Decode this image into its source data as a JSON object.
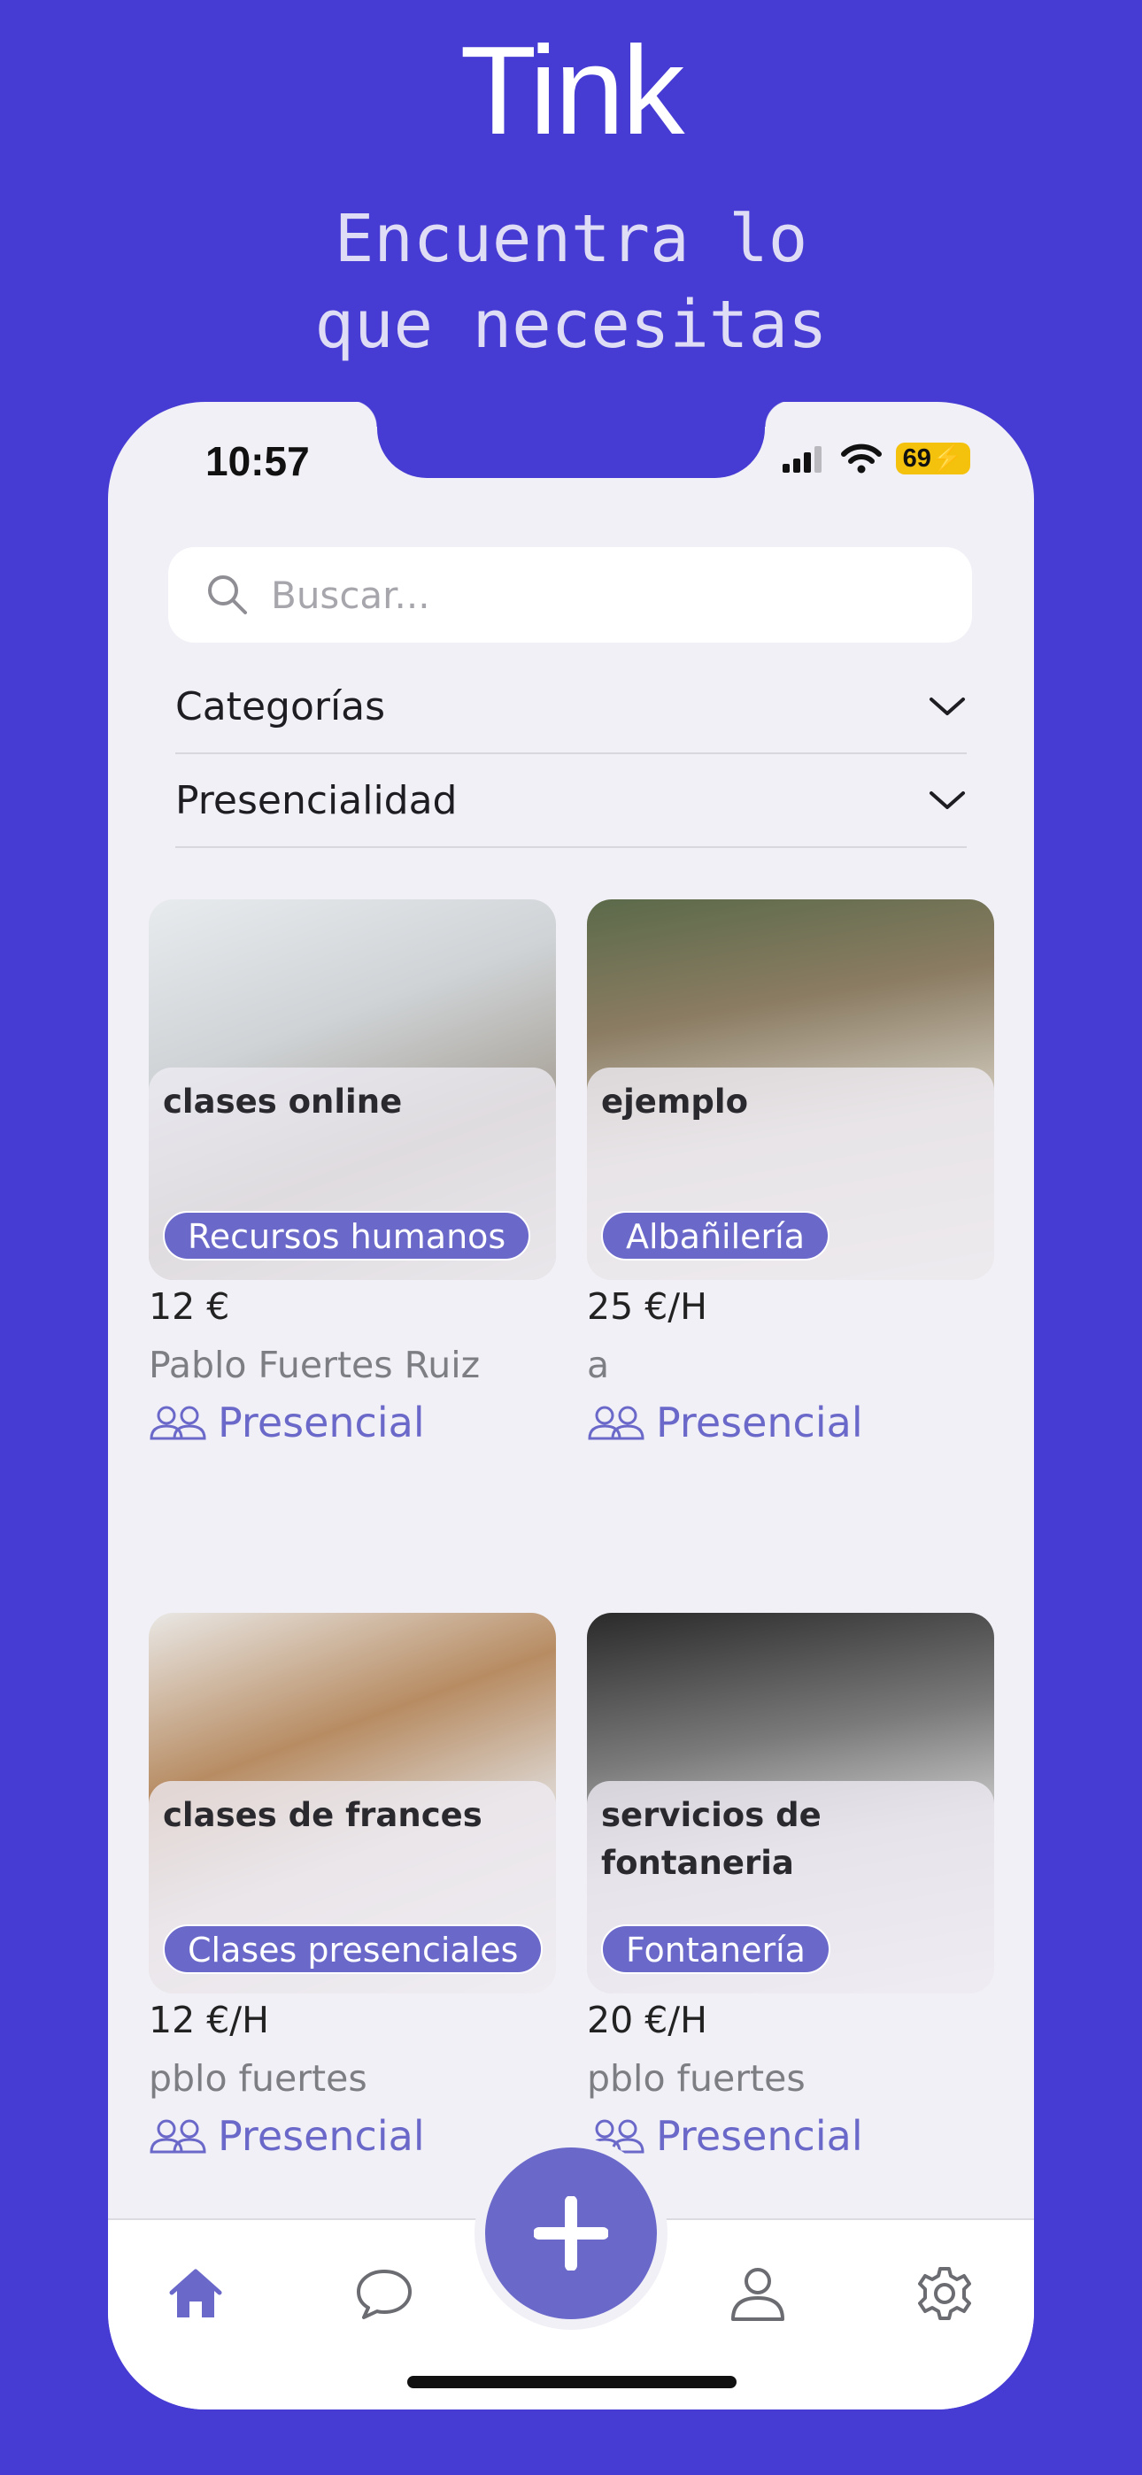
{
  "header": {
    "title": "Tink",
    "subtitle": "Encuentra lo\nque necesitas"
  },
  "status_bar": {
    "time": "10:57",
    "battery": "69"
  },
  "search": {
    "placeholder": "Buscar..."
  },
  "filters": [
    {
      "label": "Categorías"
    },
    {
      "label": "Presencialidad"
    }
  ],
  "cards": [
    {
      "title": "clases online",
      "category": "Recursos humanos",
      "price": "12 €",
      "author": "Pablo Fuertes Ruiz",
      "mode": "Presencial"
    },
    {
      "title": "ejemplo",
      "category": "Albañilería",
      "price": "25 €/H",
      "author": "a",
      "mode": "Presencial"
    },
    {
      "title": "clases de frances",
      "category": "Clases presenciales",
      "price": "12 €/H",
      "author": "pblo fuertes",
      "mode": "Presencial"
    },
    {
      "title": "servicios de fontaneria",
      "category": "Fontanería",
      "price": "20 €/H",
      "author": "pblo fuertes",
      "mode": "Presencial"
    }
  ],
  "tabbar": {
    "items": [
      "home-icon",
      "chat-icon",
      "add-icon",
      "profile-icon",
      "settings-icon"
    ]
  },
  "colors": {
    "background": "#463bd3",
    "accent": "#6a68c9",
    "surface": "#f1f0f6"
  }
}
